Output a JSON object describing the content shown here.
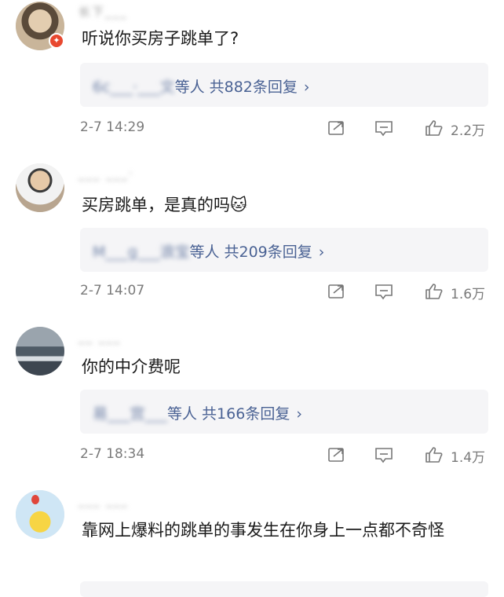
{
  "comments": [
    {
      "username": "长下___",
      "text": "听说你买房子跳单了?",
      "reply_blurred": "6c___·___文",
      "reply_suffix": "等人 共882条回复",
      "time": "2-7 14:29",
      "likes": "2.2万",
      "avatar_color": "#c9b59a",
      "has_badge": true
    },
    {
      "username": "___ ___·",
      "text": "买房跳单，是真的吗🐱",
      "reply_blurred": "M___g___浪宝",
      "reply_suffix": "等人 共209条回复",
      "time": "2-7 14:07",
      "likes": "1.6万",
      "avatar_color": "#b8a58f",
      "has_badge": false
    },
    {
      "username": "__ ___",
      "text": "你的中介费呢",
      "reply_blurred": "易___宫___",
      "reply_suffix": "等人 共166条回复",
      "time": "2-7 18:34",
      "likes": "1.4万",
      "avatar_color": "#6e7a84",
      "has_badge": false
    },
    {
      "username": "___ ___",
      "text": "靠网上爆料的跳单的事发生在你身上一点都不奇怪",
      "time": "",
      "likes": "",
      "avatar_color": "#cfe6f5",
      "has_badge": false
    }
  ],
  "icons": [
    "share-icon",
    "comment-icon",
    "like-icon"
  ],
  "colors": {
    "reply_link": "#4a6294",
    "meta_gray": "#7a7a7a",
    "reply_bg": "#f5f5f7"
  }
}
